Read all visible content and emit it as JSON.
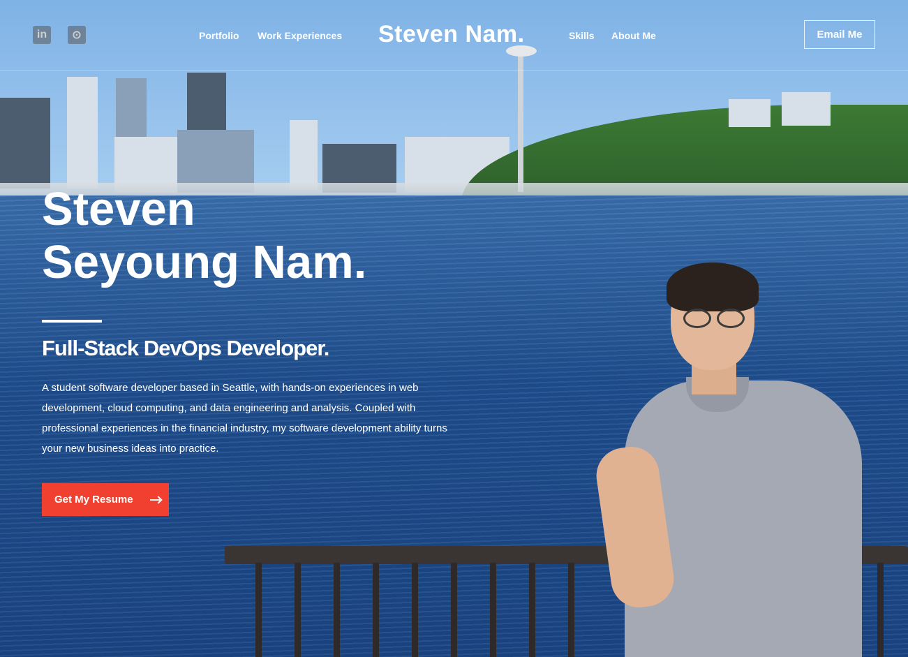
{
  "header": {
    "social": [
      {
        "icon": "linkedin-icon",
        "glyph": "in"
      },
      {
        "icon": "github-icon",
        "glyph": "⊙"
      }
    ],
    "nav_left": [
      "Portfolio",
      "Work Experiences"
    ],
    "brand": "Steven Nam.",
    "nav_right": [
      "Skills",
      "About Me"
    ],
    "email_button": "Email Me"
  },
  "hero": {
    "name_line1": "Steven",
    "name_line2": "Seyoung Nam.",
    "role": "Full-Stack DevOps Developer.",
    "description": "A student software developer based in Seattle, with hands-on experiences in web development, cloud computing, and data engineering and analysis. Coupled with professional experiences in the financial industry, my software development ability turns your new business ideas into practice.",
    "resume_button": "Get My Resume"
  },
  "colors": {
    "accent": "#f1402f",
    "text": "#ffffff"
  }
}
